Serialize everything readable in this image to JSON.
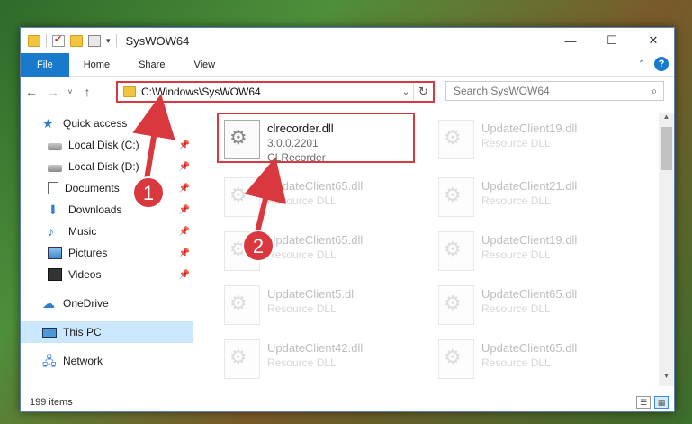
{
  "window": {
    "title": "SysWOW64"
  },
  "controls": {
    "minimize": "—",
    "maximize": "☐",
    "close": "✕"
  },
  "ribbon": {
    "tabs": [
      {
        "label": "File"
      },
      {
        "label": "Home"
      },
      {
        "label": "Share"
      },
      {
        "label": "View"
      }
    ],
    "help": "?"
  },
  "nav": {
    "back": "←",
    "forward": "→",
    "recent": "˅",
    "up": "↑"
  },
  "address": {
    "path": "C:\\Windows\\SysWOW64",
    "dropdown": "⌄",
    "refresh": "↻"
  },
  "search": {
    "placeholder": "Search SysWOW64",
    "icon": "⌕"
  },
  "sidebar": {
    "items": [
      {
        "label": "Quick access",
        "icon": "star-icon"
      },
      {
        "label": "Local Disk (C:)",
        "icon": "drive-icon",
        "pinned": true
      },
      {
        "label": "Local Disk (D:)",
        "icon": "drive-icon",
        "pinned": true
      },
      {
        "label": "Documents",
        "icon": "documents-icon",
        "pinned": true
      },
      {
        "label": "Downloads",
        "icon": "downloads-icon",
        "pinned": true
      },
      {
        "label": "Music",
        "icon": "music-icon",
        "pinned": true
      },
      {
        "label": "Pictures",
        "icon": "pictures-icon",
        "pinned": true
      },
      {
        "label": "Videos",
        "icon": "videos-icon",
        "pinned": true
      },
      {
        "label": "OneDrive",
        "icon": "cloud-icon"
      },
      {
        "label": "This PC",
        "icon": "computer-icon",
        "selected": true
      },
      {
        "label": "Network",
        "icon": "network-icon"
      }
    ]
  },
  "files": [
    {
      "name": "clrecorder.dll",
      "line2": "3.0.0.2201",
      "line3": "CLRecorder",
      "highlight": true
    },
    {
      "name": "UpdateClient19.dll",
      "line2": "Resource DLL"
    },
    {
      "name": "UpdateClient65.dll",
      "line2": "Resource DLL"
    },
    {
      "name": "UpdateClient21.dll",
      "line2": "Resource DLL"
    },
    {
      "name": "UpdateClient65.dll",
      "line2": "Resource DLL"
    },
    {
      "name": "UpdateClient19.dll",
      "line2": "Resource DLL"
    },
    {
      "name": "UpdateClient5.dll",
      "line2": "Resource DLL"
    },
    {
      "name": "UpdateClient65.dll",
      "line2": "Resource DLL"
    },
    {
      "name": "UpdateClient42.dll",
      "line2": "Resource DLL"
    },
    {
      "name": "UpdateClient65.dll",
      "line2": "Resource DLL"
    }
  ],
  "status": {
    "count": "199 items"
  },
  "annotations": {
    "step1": "1",
    "step2": "2",
    "color": "#d8383e"
  }
}
